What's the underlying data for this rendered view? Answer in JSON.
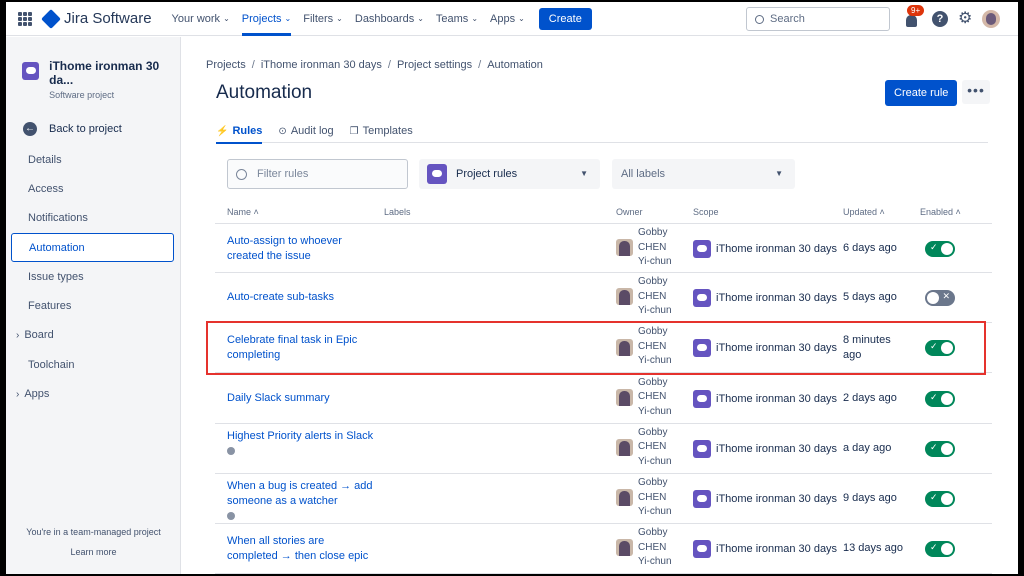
{
  "topnav": {
    "logo": "Jira Software",
    "items": [
      {
        "label": "Your work",
        "chevron": true,
        "active": false
      },
      {
        "label": "Projects",
        "chevron": true,
        "active": true
      },
      {
        "label": "Filters",
        "chevron": true,
        "active": false
      },
      {
        "label": "Dashboards",
        "chevron": true,
        "active": false
      },
      {
        "label": "Teams",
        "chevron": true,
        "active": false
      },
      {
        "label": "Apps",
        "chevron": true,
        "active": false
      }
    ],
    "create_label": "Create",
    "search_placeholder": "Search",
    "notification_badge": "9+",
    "help_label": "?"
  },
  "sidebar": {
    "project_name": "iThome ironman 30 da...",
    "project_type": "Software project",
    "back_label": "Back to project",
    "items": [
      {
        "label": "Details"
      },
      {
        "label": "Access"
      },
      {
        "label": "Notifications"
      },
      {
        "label": "Automation",
        "selected": true
      },
      {
        "label": "Issue types"
      },
      {
        "label": "Features"
      },
      {
        "label": "Board",
        "caret": true
      },
      {
        "label": "Toolchain"
      },
      {
        "label": "Apps",
        "caret": true
      }
    ],
    "footer_text": "You're in a team-managed project",
    "footer_link": "Learn more"
  },
  "main": {
    "breadcrumb": [
      "Projects",
      "iThome ironman 30 days",
      "Project settings",
      "Automation"
    ],
    "title": "Automation",
    "create_rule_label": "Create rule",
    "more_label": "•••",
    "tabs": [
      {
        "label": "Rules",
        "icon": "⚡",
        "active": true
      },
      {
        "label": "Audit log",
        "icon": "⊙",
        "active": false
      },
      {
        "label": "Templates",
        "icon": "❐",
        "active": false
      }
    ],
    "filter_placeholder": "Filter rules",
    "project_select": "Project rules",
    "labels_select": "All labels",
    "columns": {
      "name": "Name ˄",
      "labels": "Labels",
      "owner": "Owner",
      "scope": "Scope",
      "updated": "Updated ˄",
      "enabled": "Enabled ˄"
    },
    "rules": [
      {
        "name": "Auto-assign to whoever created the issue",
        "owner": "Gobby CHEN Yi-chun",
        "scope": "iThome ironman 30 days",
        "updated": "6 days ago",
        "enabled": true,
        "info": false
      },
      {
        "name": "Auto-create sub-tasks",
        "owner": "Gobby CHEN Yi-chun",
        "scope": "iThome ironman 30 days",
        "updated": "5 days ago",
        "enabled": false,
        "info": false
      },
      {
        "name": "Celebrate final task in Epic completing",
        "owner": "Gobby CHEN Yi-chun",
        "scope": "iThome ironman 30 days",
        "updated": "8 minutes ago",
        "enabled": true,
        "info": false,
        "highlighted": true
      },
      {
        "name": "Daily Slack summary",
        "owner": "Gobby CHEN Yi-chun",
        "scope": "iThome ironman 30 days",
        "updated": "2 days ago",
        "enabled": true,
        "info": false
      },
      {
        "name": "Highest Priority alerts in Slack",
        "owner": "Gobby CHEN Yi-chun",
        "scope": "iThome ironman 30 days",
        "updated": "a day ago",
        "enabled": true,
        "info": true
      },
      {
        "name": "When a bug is created → add someone as a watcher",
        "owner": "Gobby CHEN Yi-chun",
        "scope": "iThome ironman 30 days",
        "updated": "9 days ago",
        "enabled": true,
        "info": true
      },
      {
        "name": "When all stories are completed → then close epic",
        "owner": "Gobby CHEN Yi-chun",
        "scope": "iThome ironman 30 days",
        "updated": "13 days ago",
        "enabled": true,
        "info": false
      }
    ]
  },
  "colors": {
    "accent": "#0052cc",
    "toggle_on": "#00875a",
    "toggle_off": "#6b778c",
    "highlight": "#e5322d"
  }
}
